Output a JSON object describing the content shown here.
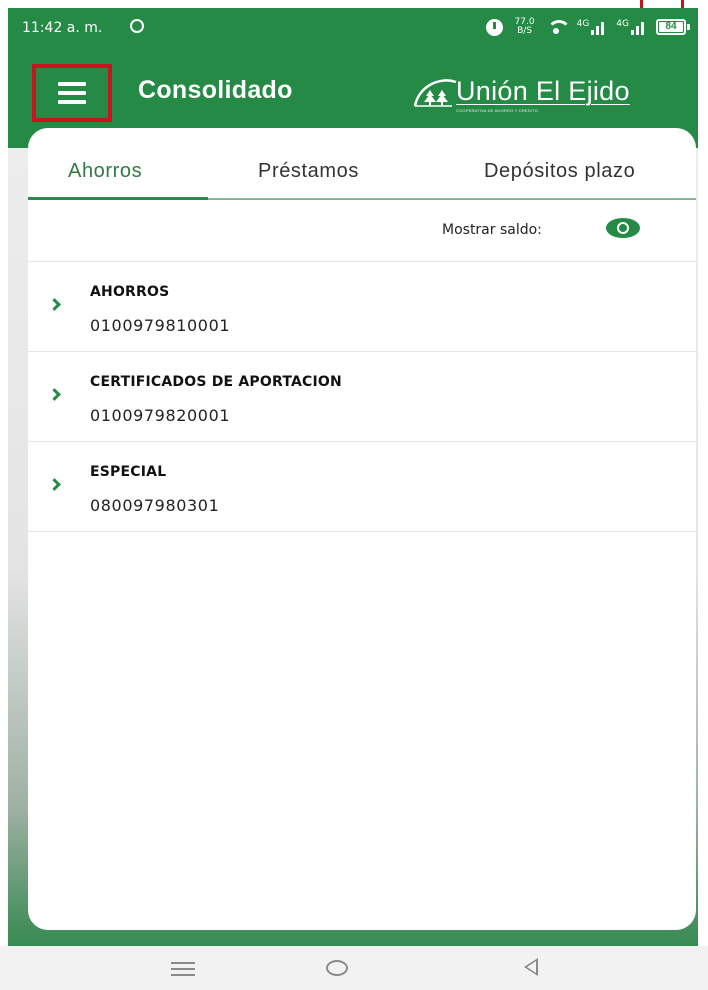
{
  "status_bar": {
    "time": "11:42 a. m.",
    "network_speed_value": "77.0",
    "network_speed_unit": "B/S",
    "signal_1_label": "4G",
    "signal_2_label": "4G",
    "battery_level": "84"
  },
  "app_bar": {
    "title": "Consolidado",
    "brand_name": "Unión El Ejido",
    "brand_tagline": "COOPERATIVA DE AHORRO Y CREDITO"
  },
  "tabs": [
    {
      "label": "Ahorros",
      "active": true
    },
    {
      "label": "Préstamos",
      "active": false
    },
    {
      "label": "Depósitos plazo",
      "active": false
    }
  ],
  "balance_toggle": {
    "label": "Mostrar saldo:"
  },
  "accounts": [
    {
      "name": "AHORROS",
      "number": "0100979810001"
    },
    {
      "name": "CERTIFICADOS DE APORTACION",
      "number": "0100979820001"
    },
    {
      "name": "ESPECIAL",
      "number": "080097980301"
    }
  ],
  "colors": {
    "brand_green": "#258a45",
    "highlight_red": "#c4161c",
    "active_tab": "#2f7a46"
  },
  "icons": [
    "menu-icon",
    "eye-icon",
    "chevron-right-icon",
    "alarm-icon",
    "wifi-icon",
    "battery-icon",
    "nav-menu-icon",
    "nav-home-icon",
    "nav-back-icon"
  ]
}
